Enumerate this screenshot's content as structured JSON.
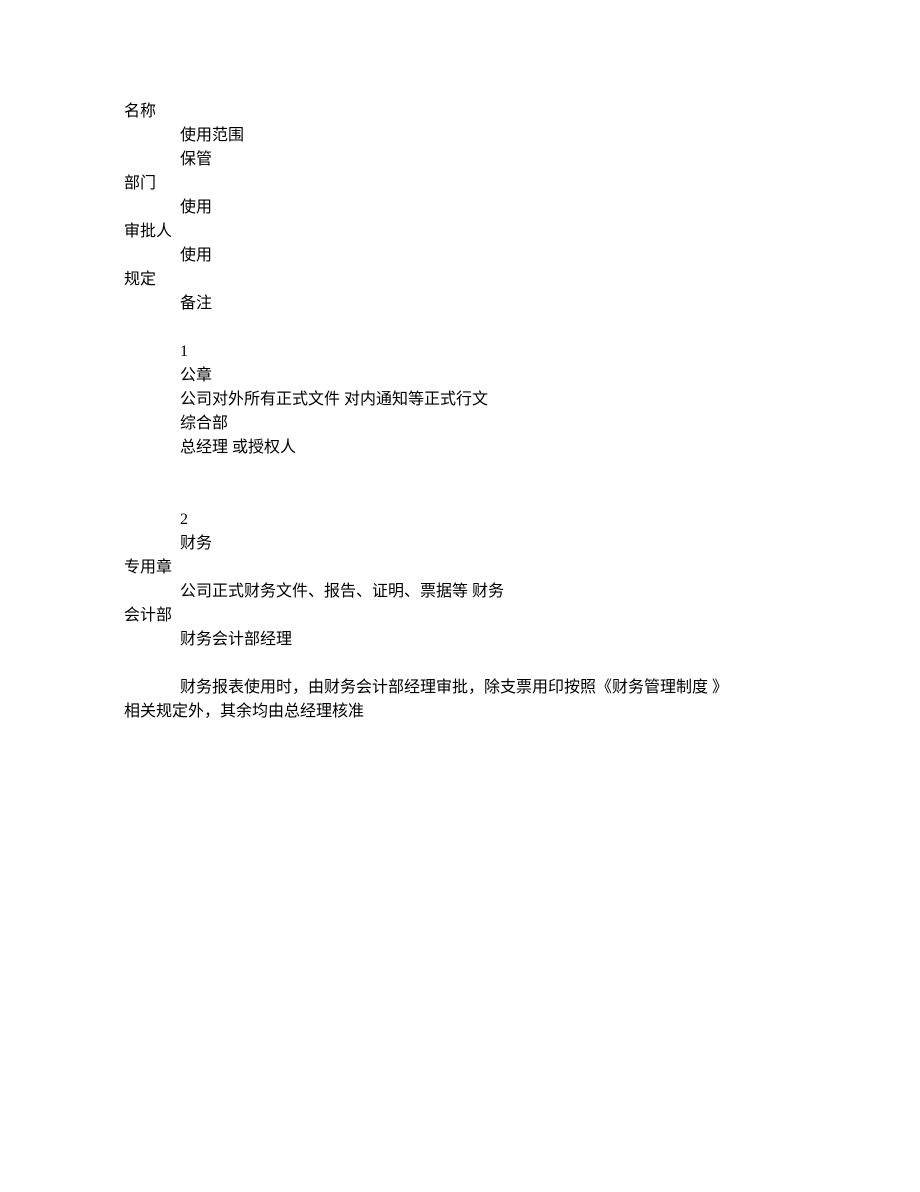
{
  "headers": {
    "name": "名称",
    "usage_scope": "使用范围",
    "custody": "保管",
    "department": "部门",
    "use1": "使用",
    "approver": "审批人",
    "use2": "使用",
    "regulation": "规定",
    "remark": "备注"
  },
  "entry1": {
    "number": "1",
    "seal_name": "公章",
    "usage_scope": "公司对外所有正式文件  对内通知等正式行文",
    "custody_dept": "综合部",
    "approver": "总经理  或授权人"
  },
  "entry2": {
    "number": "2",
    "seal_name_part1": "财务",
    "seal_name_part2": "专用章",
    "usage_scope_part1": "公司正式财务文件、报告、证明、票据等  财务",
    "usage_scope_part2": "会计部",
    "approver": "财务会计部经理",
    "regulation_line1": "财务报表使用时，由财务会计部经理审批，除支票用印按照《财务管理制度  》",
    "regulation_line2": "相关规定外，其余均由总经理核准"
  }
}
